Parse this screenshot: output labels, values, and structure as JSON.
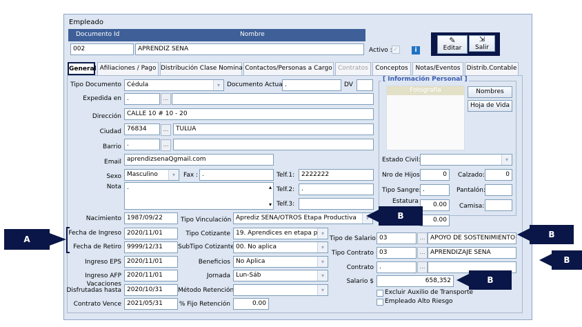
{
  "window": {
    "title": "Empleado"
  },
  "header": {
    "doc_label": "Documento Id",
    "name_label": "Nombre",
    "doc_value": "002",
    "name_value": "APRENDIZ SENA",
    "activo_label": "Activo :",
    "editar_label": "Editar",
    "salir_label": "Salir"
  },
  "tabs": [
    "General",
    "Afiliaciones / Pago",
    "Distribución Clase Nomina",
    "Contactos/Personas a Cargo",
    "Contratos",
    "Conceptos",
    "Notas/Eventos",
    "Distrib.Contable"
  ],
  "form": {
    "tipo_documento_label": "Tipo Documento",
    "tipo_documento_value": "Cédula",
    "documento_actual_label": "Documento Actual",
    "documento_actual_value": ".",
    "dv_label": "DV",
    "expedida_label": "Expedida en",
    "expedida_value": ".",
    "direccion_label": "Dirección",
    "direccion_value": "CALLE 10 # 10 - 20",
    "ciudad_label": "Ciudad",
    "ciudad_code": "76834",
    "ciudad_name": "TULUA",
    "barrio_label": "Barrio",
    "barrio_value": ".",
    "email_label": "Email",
    "email_value": "aprendizsenaQgmail.com",
    "sexo_label": "Sexo",
    "sexo_value": "Masculino",
    "fax_label": "Fax :",
    "fax_value": ".",
    "telf1_label": "Telf.1:",
    "telf1_value": "2222222",
    "nota_label": "Nota",
    "nota_value": ".",
    "telf2_label": "Telf.2:",
    "telf2_value": ".",
    "telf3_label": "Telf.3:",
    "telf3_value": "",
    "nacimiento_label": "Nacimiento",
    "nacimiento_value": "1987/09/22",
    "tipo_vinculacion_label": "Tipo Vinculación",
    "tipo_vinculacion_value": "Aprediz SENA/OTROS Etapa Productiva",
    "fecha_ingreso_label": "Fecha de Ingreso",
    "fecha_ingreso_value": "2020/11/01",
    "tipo_cotizante_label": "Tipo Cotizante",
    "tipo_cotizante_value": "19. Aprendices en etapa produ",
    "tipo_salario_label": "Tipo de Salario",
    "tipo_salario_code": "03",
    "tipo_salario_name": "APOYO DE SOSTENIMIENTO",
    "fecha_retiro_label": "Fecha de Retiro",
    "fecha_retiro_value": "9999/12/31",
    "subtipo_cotizante_label": "SubTipo Cotizante",
    "subtipo_cotizante_value": "00. No aplica",
    "tipo_contrato_label": "Tipo Contrato",
    "tipo_contrato_code": "03",
    "tipo_contrato_name": "APRENDIZAJE SENA",
    "ingreso_eps_label": "Ingreso EPS",
    "ingreso_eps_value": "2020/11/01",
    "beneficios_label": "Beneficios",
    "beneficios_value": "No Aplica",
    "contrato_label": "Contrato",
    "contrato_code": ".",
    "contrato_name": "",
    "ingreso_afp_label": "Ingreso AFP",
    "ingreso_afp_value": "2020/11/01",
    "jornada_label": "Jornada",
    "jornada_value": "Lun-Sáb",
    "salario_label": "Salario $",
    "salario_value": "658,352",
    "vacaciones_label_1": "Vacaciones",
    "vacaciones_label_2": "Disfrutadas hasta",
    "vacaciones_value": "2020/10/31",
    "metodo_retencion_label": "Método Retención",
    "metodo_retencion_value": "",
    "excluir_auxilio_label": "Excluir Auxilio de Transporte",
    "contrato_vence_label": "Contrato Vence",
    "contrato_vence_value": "2021/05/31",
    "fijo_retencion_label": "% Fijo Retención",
    "fijo_retencion_value": "0.00",
    "empleado_alto_riesgo_label": "Empleado Alto Riesgo"
  },
  "personal": {
    "title": "[ Información Personal ]",
    "foto_label": "Fotografía",
    "nombres_button": "Nombres",
    "hoja_vida_button": "Hoja de Vida",
    "estado_civil_label": "Estado Civil:",
    "estado_civil_value": "",
    "nro_hijos_label": "Nro de Hijos",
    "nro_hijos_value": "0",
    "calzado_label": "Calzado:",
    "calzado_value": "0",
    "tipo_sangre_label": "Tipo Sangre:",
    "tipo_sangre_value": ".",
    "pantalon_label": "Pantalón:",
    "pantalon_value": "",
    "estatura_label": "Estatura",
    "estatura_value": "0.00",
    "camisa_label": "Camisa:",
    "camisa_value": "",
    "peso_value": "0.00"
  },
  "callouts": {
    "a": "A",
    "b1": "B",
    "b2": "B",
    "b3": "B",
    "b4": "B"
  },
  "colors": {
    "callout_bg": "#0a1647",
    "header_bar": "#3e5f98",
    "active_tab_border": "#0b1c4a",
    "personal_title": "#3a5cb0"
  }
}
